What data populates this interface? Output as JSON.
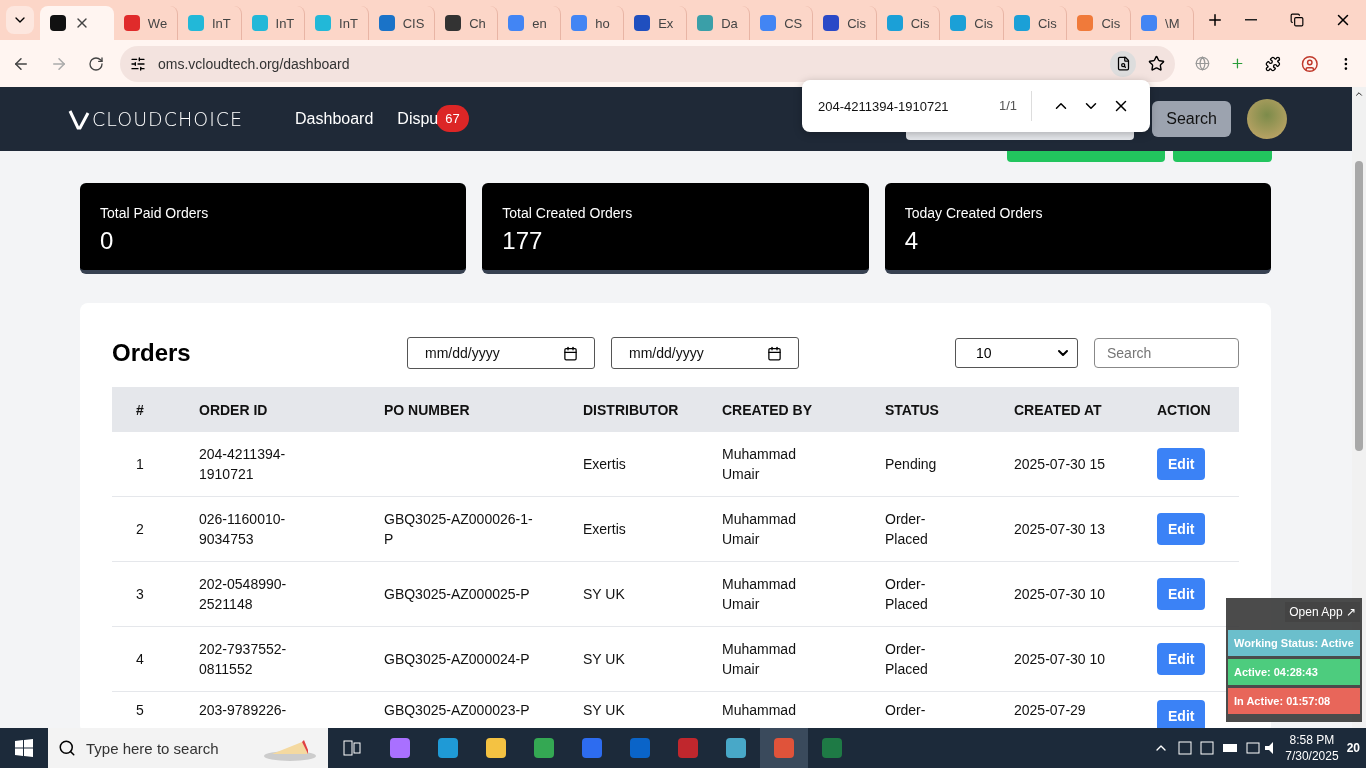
{
  "browser": {
    "tabs": [
      {
        "selected": true,
        "color": "#111111"
      },
      {
        "title": "We",
        "selected": false,
        "color": "#e02b2b"
      },
      {
        "title": "InT",
        "selected": false,
        "color": "#22b8d8"
      },
      {
        "title": "InT",
        "selected": false,
        "color": "#22b8d8"
      },
      {
        "title": "InT",
        "selected": false,
        "color": "#22b8d8"
      },
      {
        "title": "CIS",
        "selected": false,
        "color": "#1a73c8"
      },
      {
        "title": "Ch",
        "selected": false,
        "color": "#333333"
      },
      {
        "title": "en",
        "selected": false,
        "color": "#4285f4"
      },
      {
        "title": "ho",
        "selected": false,
        "color": "#4285f4"
      },
      {
        "title": "Ex",
        "selected": false,
        "color": "#1f4fbf"
      },
      {
        "title": "Da",
        "selected": false,
        "color": "#3a9fa8"
      },
      {
        "title": "CS",
        "selected": false,
        "color": "#4285f4"
      },
      {
        "title": "Cis",
        "selected": false,
        "color": "#2a49c7"
      },
      {
        "title": "Cis",
        "selected": false,
        "color": "#1ba0d7"
      },
      {
        "title": "Cis",
        "selected": false,
        "color": "#1ba0d7"
      },
      {
        "title": "Cis",
        "selected": false,
        "color": "#1ba0d7"
      },
      {
        "title": "Cis",
        "selected": false,
        "color": "#f07a3a"
      },
      {
        "title": "\\M",
        "selected": false,
        "color": "#4285f4"
      }
    ],
    "address": "oms.vcloudtech.org/dashboard"
  },
  "find_bar": {
    "query": "204-4211394-1910721",
    "count": "1/1"
  },
  "header": {
    "logo": "CLOUDCHOICE",
    "nav": [
      {
        "label": "Dashboard"
      },
      {
        "label": "Dispu",
        "badge": "67"
      }
    ],
    "search_button": "Search"
  },
  "stats": [
    {
      "label": "Total Paid Orders",
      "value": "0"
    },
    {
      "label": "Total Created Orders",
      "value": "177"
    },
    {
      "label": "Today Created Orders",
      "value": "4"
    }
  ],
  "orders": {
    "title": "Orders",
    "date_from": {
      "placeholder": "mm/dd/yyyy"
    },
    "date_to": {
      "placeholder": "mm/dd/yyyy"
    },
    "page_size": "10",
    "search": {
      "placeholder": "Search"
    },
    "table": {
      "columns": [
        "#",
        "ORDER ID",
        "PO NUMBER",
        "DISTRIBUTOR",
        "CREATED BY",
        "STATUS",
        "CREATED AT",
        "ACTION"
      ],
      "rows": [
        {
          "index": "1",
          "order_id": "204-4211394-1910721",
          "distributor": "Exertis",
          "created_by": "Muhammad Umair",
          "status": "Pending",
          "created_at": "2025-07-30 15",
          "action": "Edit"
        },
        {
          "index": "2",
          "order_id": "026-1160010-9034753",
          "po_number": "GBQ3025-AZ000026-1-P",
          "distributor": "Exertis",
          "created_by": "Muhammad Umair",
          "status": "Order-Placed",
          "created_at": "2025-07-30 13",
          "action": "Edit"
        },
        {
          "index": "3",
          "order_id": "202-0548990-2521148",
          "po_number": "GBQ3025-AZ000025-P",
          "distributor": "SY UK",
          "created_by": "Muhammad Umair",
          "status": "Order-Placed",
          "created_at": "2025-07-30 10",
          "action": "Edit"
        },
        {
          "index": "4",
          "order_id": "202-7937552-0811552",
          "po_number": "GBQ3025-AZ000024-P",
          "distributor": "SY UK",
          "created_by": "Muhammad Umair",
          "status": "Order-Placed",
          "created_at": "2025-07-30 10",
          "action": "Edit"
        },
        {
          "index": "5",
          "order_id": "203-9789226-",
          "po_number": "GBQ3025-AZ000023-P",
          "distributor": "SY UK",
          "created_by": "Muhammad",
          "status": "Order-",
          "created_at": "2025-07-29",
          "action": "Edit"
        }
      ]
    }
  },
  "tracker": {
    "open_app": "Open App ↗",
    "lines": [
      {
        "kind": "status",
        "text": "Working Status: Active"
      },
      {
        "kind": "active",
        "text": "Active: 04:28:43"
      },
      {
        "kind": "inactive",
        "text": "In Active: 01:57:08"
      }
    ]
  },
  "taskbar": {
    "search": {
      "placeholder": "Type here to search"
    },
    "time": "8:58 PM",
    "date": "7/30/2025",
    "notifications": "20"
  }
}
